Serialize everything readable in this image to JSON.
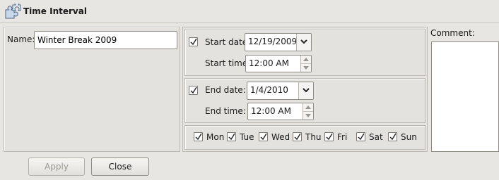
{
  "window": {
    "title": "Time Interval",
    "icon": "puzzle-icon"
  },
  "name": {
    "label": "Name:",
    "value": "Winter Break 2009"
  },
  "start": {
    "enabled": true,
    "date_label": "Start date:",
    "date_value": "12/19/2009",
    "time_label": "Start time:",
    "time_value": "12:00 AM"
  },
  "end": {
    "enabled": true,
    "date_label": "End date:",
    "date_value": "1/4/2010",
    "time_label": "End time:",
    "time_value": "12:00 AM"
  },
  "days": [
    {
      "label": "Mon",
      "checked": true
    },
    {
      "label": "Tue",
      "checked": true
    },
    {
      "label": "Wed",
      "checked": true
    },
    {
      "label": "Thu",
      "checked": true
    },
    {
      "label": "Fri",
      "checked": true
    },
    {
      "label": "Sat",
      "checked": true
    },
    {
      "label": "Sun",
      "checked": true
    }
  ],
  "comment": {
    "label": "Comment:",
    "value": ""
  },
  "buttons": {
    "apply_label": "Apply",
    "apply_enabled": false,
    "close_label": "Close"
  }
}
